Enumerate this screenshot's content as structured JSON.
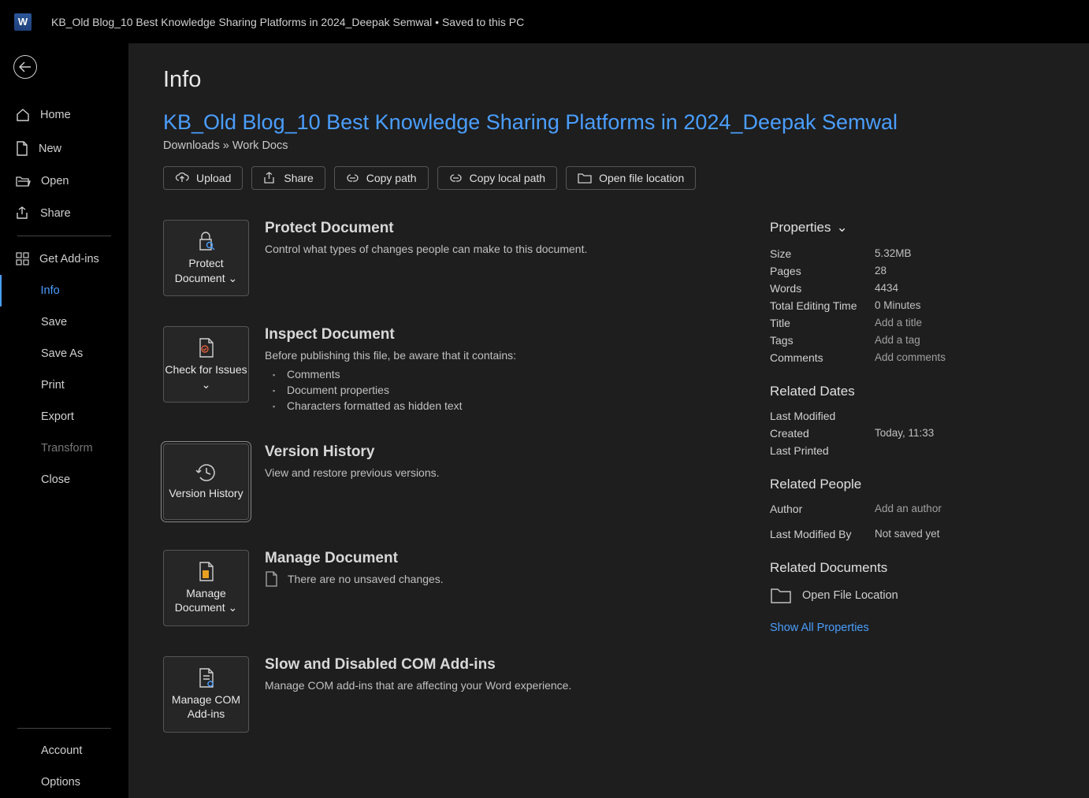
{
  "titlebar": {
    "app_letter": "W",
    "text": "KB_Old Blog_10 Best Knowledge Sharing Platforms in 2024_Deepak Semwal • Saved to this PC"
  },
  "sidebar": {
    "home": "Home",
    "new": "New",
    "open": "Open",
    "share": "Share",
    "addins": "Get Add-ins",
    "info": "Info",
    "save": "Save",
    "saveas": "Save As",
    "print": "Print",
    "export": "Export",
    "transform": "Transform",
    "close": "Close",
    "account": "Account",
    "options": "Options"
  },
  "page": {
    "title": "Info",
    "doc_title": "KB_Old Blog_10 Best Knowledge Sharing Platforms in 2024_Deepak Semwal",
    "breadcrumb": "Downloads » Work Docs"
  },
  "actions": {
    "upload": "Upload",
    "share": "Share",
    "copy_path": "Copy path",
    "copy_local": "Copy local path",
    "open_loc": "Open file location"
  },
  "sections": {
    "protect": {
      "btn": "Protect Document",
      "heading": "Protect Document",
      "text": "Control what types of changes people can make to this document."
    },
    "inspect": {
      "btn": "Check for Issues",
      "heading": "Inspect Document",
      "text": "Before publishing this file, be aware that it contains:",
      "li1": "Comments",
      "li2": "Document properties",
      "li3": "Characters formatted as hidden text"
    },
    "version": {
      "btn": "Version History",
      "heading": "Version History",
      "text": "View and restore previous versions."
    },
    "manage": {
      "btn": "Manage Document",
      "heading": "Manage Document",
      "text": "There are no unsaved changes."
    },
    "com": {
      "btn": "Manage COM Add-ins",
      "heading": "Slow and Disabled COM Add-ins",
      "text": "Manage COM add-ins that are affecting your Word experience."
    }
  },
  "properties": {
    "header": "Properties",
    "size_l": "Size",
    "size_v": "5.32MB",
    "pages_l": "Pages",
    "pages_v": "28",
    "words_l": "Words",
    "words_v": "4434",
    "editing_l": "Total Editing Time",
    "editing_v": "0 Minutes",
    "title_l": "Title",
    "title_v": "Add a title",
    "tags_l": "Tags",
    "tags_v": "Add a tag",
    "comments_l": "Comments",
    "comments_v": "Add comments",
    "dates_header": "Related Dates",
    "modified_l": "Last Modified",
    "modified_v": "",
    "created_l": "Created",
    "created_v": "Today, 11:33",
    "printed_l": "Last Printed",
    "printed_v": "",
    "people_header": "Related People",
    "author_l": "Author",
    "author_v": "Add an author",
    "lastmod_l": "Last Modified By",
    "lastmod_v": "Not saved yet",
    "docs_header": "Related Documents",
    "open_file_loc": "Open File Location",
    "show_all": "Show All Properties"
  }
}
